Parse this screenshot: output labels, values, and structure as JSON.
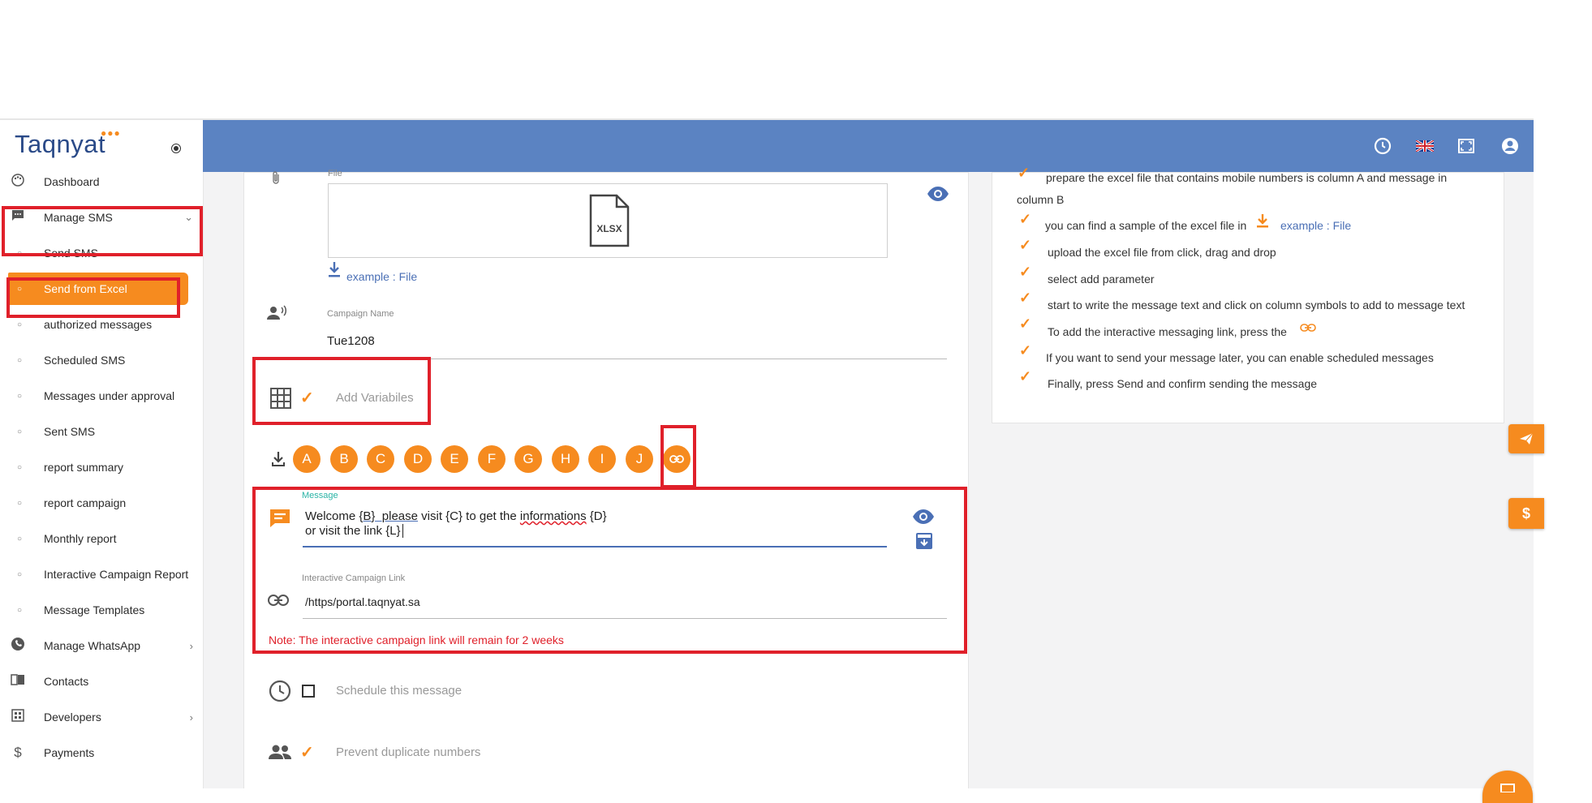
{
  "brand": {
    "logo_text": "Taqnyat",
    "accent": "#f68b1f",
    "topbar_color": "#5b83c2",
    "highlight": "#e0202a"
  },
  "sidebar": {
    "items": [
      {
        "label": "Dashboard",
        "icon": "palette-icon"
      },
      {
        "label": "Manage SMS",
        "icon": "sms-icon"
      },
      {
        "label": "Send SMS",
        "icon": "circle-icon"
      },
      {
        "label": "Send from Excel",
        "icon": "circle-icon"
      },
      {
        "label": "authorized messages",
        "icon": "circle-icon"
      },
      {
        "label": "Scheduled SMS",
        "icon": "circle-icon"
      },
      {
        "label": "Messages under approval",
        "icon": "circle-icon"
      },
      {
        "label": "Sent SMS",
        "icon": "circle-icon"
      },
      {
        "label": "report summary",
        "icon": "circle-icon"
      },
      {
        "label": "report campaign",
        "icon": "circle-icon"
      },
      {
        "label": "Monthly report",
        "icon": "circle-icon"
      },
      {
        "label": "Interactive Campaign Report",
        "icon": "circle-icon"
      },
      {
        "label": "Message Templates",
        "icon": "circle-icon"
      },
      {
        "label": "Manage WhatsApp",
        "icon": "whatsapp-icon"
      },
      {
        "label": "Contacts",
        "icon": "contacts-icon"
      },
      {
        "label": "Developers",
        "icon": "developers-icon"
      },
      {
        "label": "Payments",
        "icon": "dollar-icon"
      }
    ]
  },
  "form": {
    "file_label": "File",
    "file_type": "XLSX",
    "example_link": "example : File",
    "campaign_name_label": "Campaign Name",
    "campaign_name_value": "Tue1208",
    "add_variables_label": "Add Variabiles",
    "variables": [
      "A",
      "B",
      "C",
      "D",
      "E",
      "F",
      "G",
      "H",
      "I",
      "J"
    ],
    "message_label": "Message",
    "message_line1_a": "Welcome ",
    "message_line1_b": "{B}  please",
    "message_line1_c": " visit {C} to get the ",
    "message_line1_d": "informations",
    "message_line1_e": " {D}",
    "message_line2": "or visit the link {L}",
    "link_label": "Interactive Campaign Link",
    "link_value": "/https/portal.taqnyat.sa",
    "note": "Note: The interactive campaign link will remain for 2 weeks",
    "schedule_label": "Schedule this message",
    "duplicate_label": "Prevent duplicate numbers"
  },
  "instructions": {
    "line1a": "prepare the excel file that contains mobile numbers is column A and message in",
    "line1b": "column B",
    "line2": "you can find a sample of the excel file in",
    "line2_link": "example : File",
    "line3": "upload the excel file from click, drag and drop",
    "line4": "select add parameter",
    "line5": "start to write the message text and click on column symbols to add to message text",
    "line6": "To add the interactive messaging link, press the",
    "line7": "If you want to send your message later, you can enable scheduled messages",
    "line8": "Finally, press Send and confirm sending the message"
  }
}
